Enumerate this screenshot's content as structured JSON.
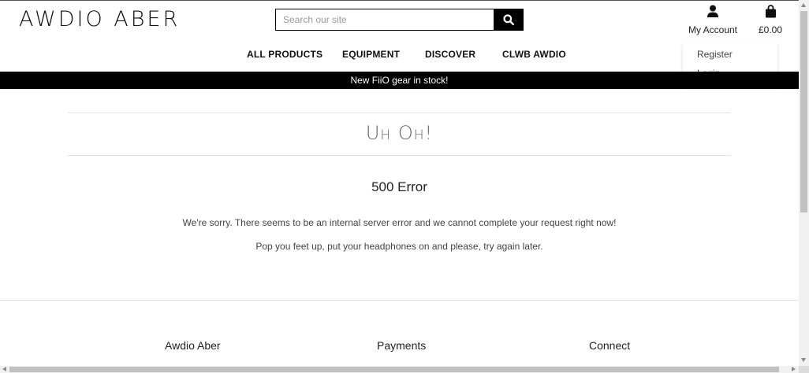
{
  "header": {
    "logo": "AWDIO ABER",
    "search": {
      "placeholder": "Search our site",
      "value": ""
    },
    "account_label": "My Account",
    "cart_total": "£0.00"
  },
  "nav": {
    "items": [
      "ALL PRODUCTS",
      "EQUIPMENT",
      "DISCOVER",
      "CLWB AWDIO"
    ]
  },
  "account_menu": {
    "items": [
      "Register",
      "Login"
    ]
  },
  "banner": {
    "text": "New FiiO gear in stock!"
  },
  "main": {
    "title": "Uh Oh!",
    "error_heading": "500 Error",
    "message_1": "We're sorry. There seems to be an internal server error and we cannot complete your request right now!",
    "message_2": "Pop you feet up, put your headphones on and please, try again later."
  },
  "footer": {
    "headings": [
      "Awdio Aber",
      "Payments",
      "Connect"
    ]
  },
  "icons": {
    "search": "search-icon",
    "account": "user-icon",
    "cart": "shopping-bag-icon"
  },
  "colors": {
    "banner_bg": "#000000",
    "banner_text": "#ffffff",
    "accent": "#000000"
  }
}
